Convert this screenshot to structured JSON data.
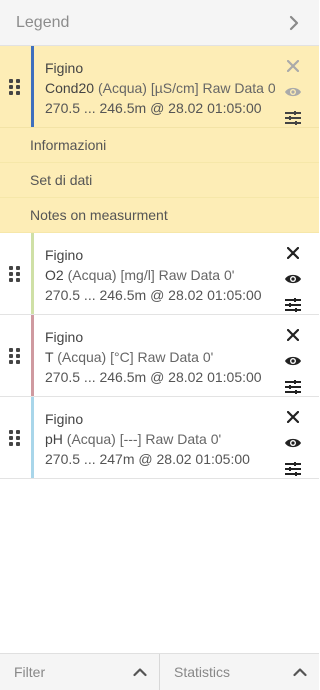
{
  "header": {
    "title": "Legend"
  },
  "selected_entry": {
    "site": "Figino",
    "param_name": "Cond20",
    "param_detail": "(Acqua) [µS/cm] Raw Data 0'",
    "range": "270.5 ... 246.5m @ 28.02 01:05:00",
    "color": "#3f6fbd",
    "submenu": [
      "Informazioni",
      "Set di dati",
      "Notes on measurment"
    ]
  },
  "entries": [
    {
      "site": "Figino",
      "param_name": "O2",
      "param_detail": "(Acqua) [mg/l] Raw Data 0'",
      "range": "270.5 ... 246.5m @ 28.02 01:05:00",
      "color": "#cfe0a6"
    },
    {
      "site": "Figino",
      "param_name": "T",
      "param_detail": "(Acqua) [°C] Raw Data 0'",
      "range": "270.5 ... 246.5m @ 28.02 01:05:00",
      "color": "#cf9aa0"
    },
    {
      "site": "Figino",
      "param_name": "pH",
      "param_detail": "(Acqua) [---] Raw Data 0'",
      "range": "270.5 ... 247m @ 28.02 01:05:00",
      "color": "#a9d6ea"
    }
  ],
  "footer": {
    "filter_label": "Filter",
    "statistics_label": "Statistics"
  }
}
